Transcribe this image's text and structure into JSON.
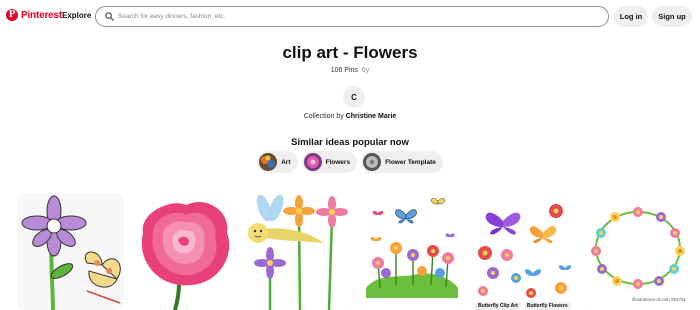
{
  "header": {
    "logo_text": "Pinterest",
    "logo_mark": "P",
    "explore_label": "Explore",
    "search_placeholder": "Search for easy dinners, fashion, etc.",
    "login_label": "Log in",
    "signup_label": "Sign up",
    "brand_color": "#e60023"
  },
  "board": {
    "title": "clip art - Flowers",
    "pin_count": "106 Pins",
    "age": "6y",
    "avatar_letter": "C",
    "collection_prefix": "Collection by",
    "owner_name": "Christine Marie"
  },
  "similar": {
    "heading": "Similar ideas popular now",
    "chips": [
      {
        "label": "Art",
        "thumb_icon": "art-thumb"
      },
      {
        "label": "Flowers",
        "thumb_icon": "flowers-thumb"
      },
      {
        "label": "Flower Template",
        "thumb_icon": "flower-template-thumb"
      }
    ]
  },
  "pins": [
    {
      "icon": "daisy-butterfly-clipart"
    },
    {
      "icon": "pink-rose-clipart"
    },
    {
      "icon": "dragonfly-flowers-clipart"
    },
    {
      "icon": "butterflies-flower-garden-clipart"
    },
    {
      "icon": "butterfly-flowers-clipart",
      "tags": [
        "Butterfly Clip Art",
        "Butterfly Flowers"
      ]
    },
    {
      "icon": "flower-wreath-clipart",
      "watermark": "illustrations-of.com  #84751"
    }
  ]
}
